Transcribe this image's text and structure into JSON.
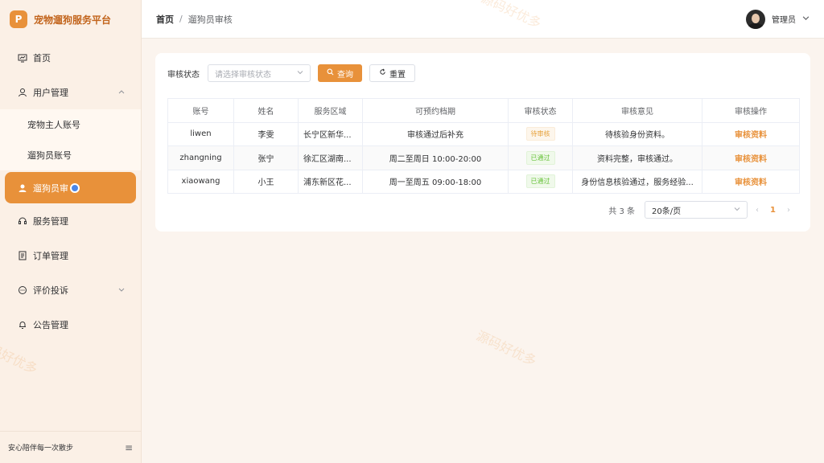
{
  "app": {
    "logo_letter": "P",
    "title": "宠物遛狗服务平台"
  },
  "sidebar": {
    "items": [
      {
        "label": "首页",
        "icon": "dashboard-icon"
      },
      {
        "label": "用户管理",
        "icon": "user-icon"
      },
      {
        "label": "遛狗员审",
        "icon": "person-icon"
      },
      {
        "label": "服务管理",
        "icon": "headset-icon"
      },
      {
        "label": "订单管理",
        "icon": "document-icon"
      },
      {
        "label": "评价投诉",
        "icon": "chat-icon"
      },
      {
        "label": "公告管理",
        "icon": "bell-icon"
      }
    ],
    "submenu": [
      "宠物主人账号",
      "遛狗员账号"
    ],
    "footer_text": "安心陪伴每一次散步"
  },
  "header": {
    "breadcrumb_home": "首页",
    "breadcrumb_sep": "/",
    "breadcrumb_current": "遛狗员审核",
    "user_name": "管理员"
  },
  "filters": {
    "status_label": "审核状态",
    "status_placeholder": "请选择审核状态",
    "query_button": "查询",
    "reset_button": "重置"
  },
  "table": {
    "headers": [
      "账号",
      "姓名",
      "服务区域",
      "可预约档期",
      "审核状态",
      "审核意见",
      "审核操作"
    ],
    "rows": [
      {
        "account": "liwen",
        "name": "李雯",
        "area": "长宁区新华...",
        "schedule": "审核通过后补充",
        "status": "待审核",
        "opinion": "待核验身份资料。",
        "action": "审核资料"
      },
      {
        "account": "zhangning",
        "name": "张宁",
        "area": "徐汇区湖南...",
        "schedule": "周二至周日 10:00-20:00",
        "status": "已通过",
        "opinion": "资料完整，审核通过。",
        "action": "审核资料"
      },
      {
        "account": "xiaowang",
        "name": "小王",
        "area": "浦东新区花...",
        "schedule": "周一至周五 09:00-18:00",
        "status": "已通过",
        "opinion": "身份信息核验通过，服务经验...",
        "action": "审核资料"
      }
    ]
  },
  "pagination": {
    "total": "共 3 条",
    "page_size": "20条/页",
    "current_page": "1",
    "prev": "‹",
    "next": "›"
  },
  "watermark": "源码好优多",
  "colors": {
    "accent": "#e8913a",
    "pending": "#e6a23c",
    "passed": "#67c23a"
  }
}
